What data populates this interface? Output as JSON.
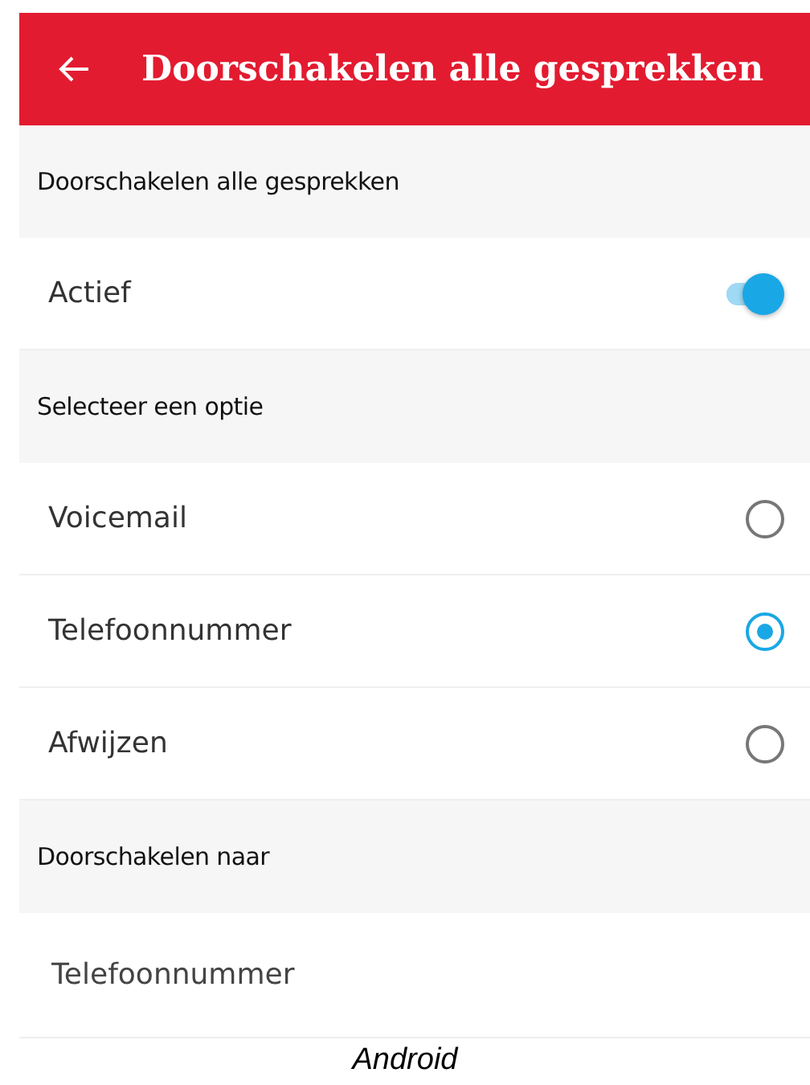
{
  "app_bar": {
    "title": "Doorschakelen alle gesprekken"
  },
  "sections": [
    {
      "heading": "Doorschakelen alle gesprekken",
      "items": [
        {
          "kind": "toggle",
          "label": "Actief",
          "on": true
        }
      ]
    },
    {
      "heading": "Selecteer een optie",
      "items": [
        {
          "kind": "radio",
          "label": "Voicemail",
          "selected": false
        },
        {
          "kind": "radio",
          "label": "Telefoonnummer",
          "selected": true
        },
        {
          "kind": "radio",
          "label": "Afwijzen",
          "selected": false
        }
      ]
    },
    {
      "heading": "Doorschakelen naar",
      "items": [
        {
          "kind": "field",
          "placeholder": "Telefoonnummer"
        }
      ]
    }
  ],
  "caption": "Android"
}
